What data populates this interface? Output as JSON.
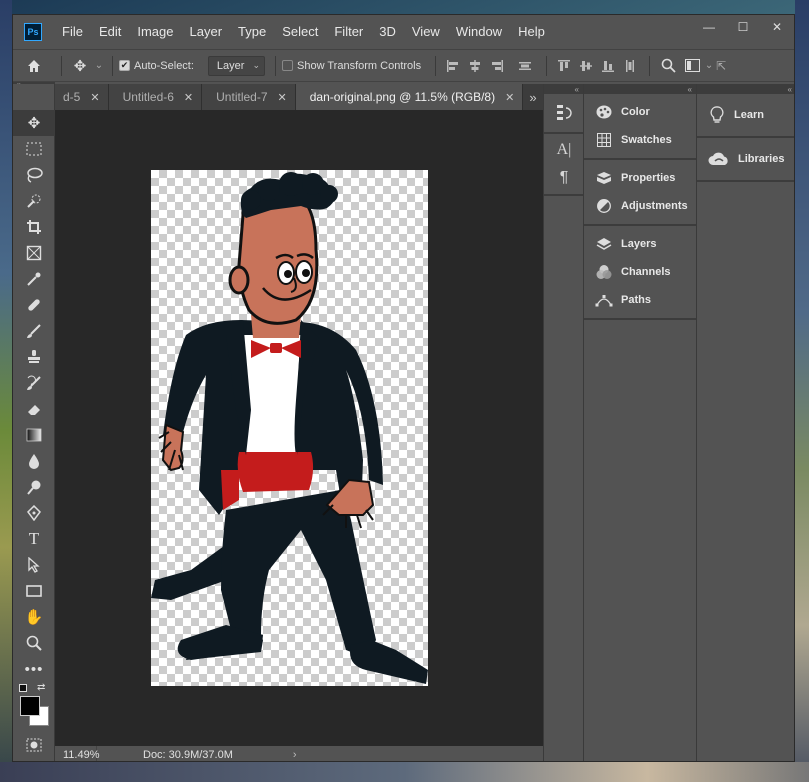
{
  "app": {
    "logo_text": "Ps"
  },
  "menu": [
    "File",
    "Edit",
    "Image",
    "Layer",
    "Type",
    "Select",
    "Filter",
    "3D",
    "View",
    "Window",
    "Help"
  ],
  "window_controls": {
    "minimize": "—",
    "maximize": "☐",
    "close": "✕"
  },
  "options": {
    "auto_select_label": "Auto-Select:",
    "auto_select_checked": true,
    "layer_select_value": "Layer",
    "show_transform_label": "Show Transform Controls",
    "show_transform_checked": false
  },
  "tabs": [
    {
      "label": "d-5",
      "close": "✕",
      "active": false
    },
    {
      "label": "Untitled-6",
      "close": "✕",
      "active": false
    },
    {
      "label": "Untitled-7",
      "close": "✕",
      "active": false
    },
    {
      "label": "dan-original.png @ 11.5% (RGB/8)",
      "close": "✕",
      "active": true
    }
  ],
  "tabs_overflow": "»",
  "status": {
    "zoom": "11.49%",
    "doc": "Doc: 30.9M/37.0M",
    "arrow": "›"
  },
  "panels": {
    "groups": [
      [
        {
          "label": "Color",
          "icon": "palette-icon"
        },
        {
          "label": "Swatches",
          "icon": "grid-icon"
        }
      ],
      [
        {
          "label": "Properties",
          "icon": "properties-icon"
        },
        {
          "label": "Adjustments",
          "icon": "adjustments-icon"
        }
      ],
      [
        {
          "label": "Layers",
          "icon": "layers-icon"
        },
        {
          "label": "Channels",
          "icon": "channels-icon"
        },
        {
          "label": "Paths",
          "icon": "paths-icon"
        }
      ]
    ],
    "right": [
      {
        "label": "Learn",
        "icon": "lightbulb-icon"
      },
      {
        "label": "Libraries",
        "icon": "cloud-icon"
      }
    ]
  },
  "colors": {
    "accent": "#31a8ff",
    "bg": "#535353",
    "canvas_bg": "#282828"
  }
}
